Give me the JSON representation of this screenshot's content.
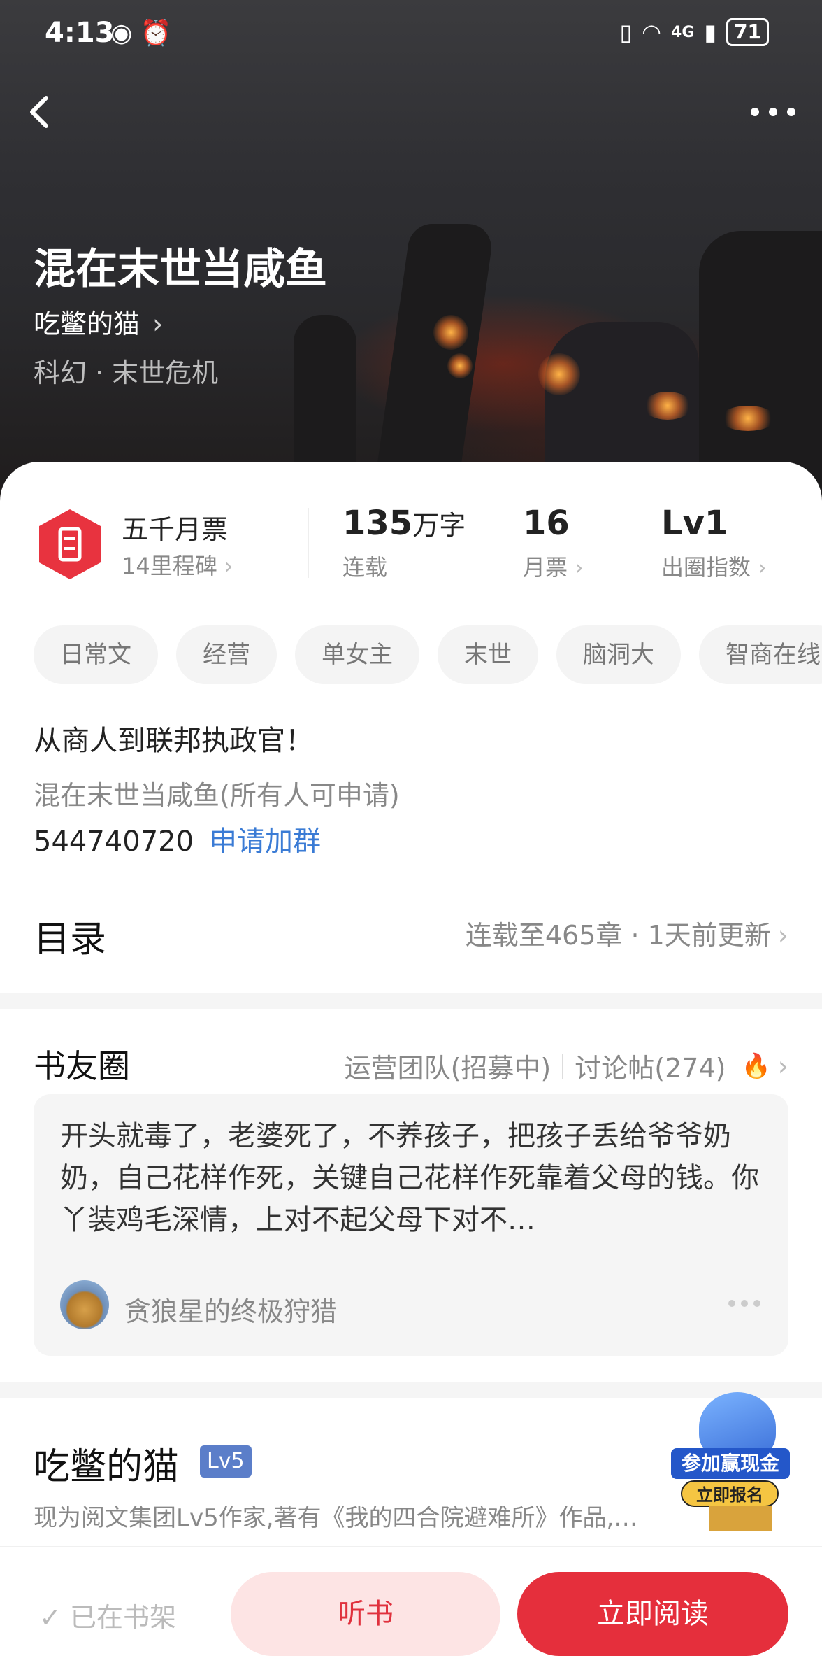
{
  "status_bar": {
    "time": "4:13",
    "battery": "71",
    "network": "4G"
  },
  "book": {
    "title": "混在末世当咸鱼",
    "author": "吃鳖的猫",
    "genre_primary": "科幻",
    "genre_secondary": "末世危机"
  },
  "stats": {
    "ticket_title": "五千月票",
    "ticket_sub": "14里程碑",
    "word_count": "135",
    "word_unit": "万字",
    "word_label": "连载",
    "monthly_tickets": "16",
    "monthly_label": "月票",
    "index_value": "Lv1",
    "index_label": "出圈指数"
  },
  "tags": [
    "日常文",
    "经营",
    "单女主",
    "末世",
    "脑洞大",
    "智商在线"
  ],
  "description": "从商人到联邦执政官！",
  "group": {
    "name": "混在末世当咸鱼(所有人可申请)",
    "number": "544740720",
    "join_label": "申请加群"
  },
  "toc": {
    "label": "目录",
    "info": "连载至465章 · 1天前更新"
  },
  "circle": {
    "label": "书友圈",
    "ops_team": "运营团队(招募中)",
    "discussions": "讨论帖(274)",
    "post_text": "开头就毒了，老婆死了，不养孩子，把孩子丢给爷爷奶奶，自己花样作死，关键自己花样作死靠着父母的钱。你丫装鸡毛深情，上对不起父母下对不…",
    "post_user": "贪狼星的终极狩猎"
  },
  "author_section": {
    "name": "吃鳖的猫",
    "level": "Lv5",
    "bio": "现为阅文集团Lv5作家,著有《我的四合院避难所》作品,…"
  },
  "promo": {
    "line1": "参加赢现金",
    "line2": "立即报名"
  },
  "bottom_bar": {
    "shelf": "已在书架",
    "listen": "听书",
    "read": "立即阅读"
  },
  "colors": {
    "accent": "#e52f3c",
    "link": "#3a7bd5",
    "lv_badge": "#5b7ec9"
  }
}
